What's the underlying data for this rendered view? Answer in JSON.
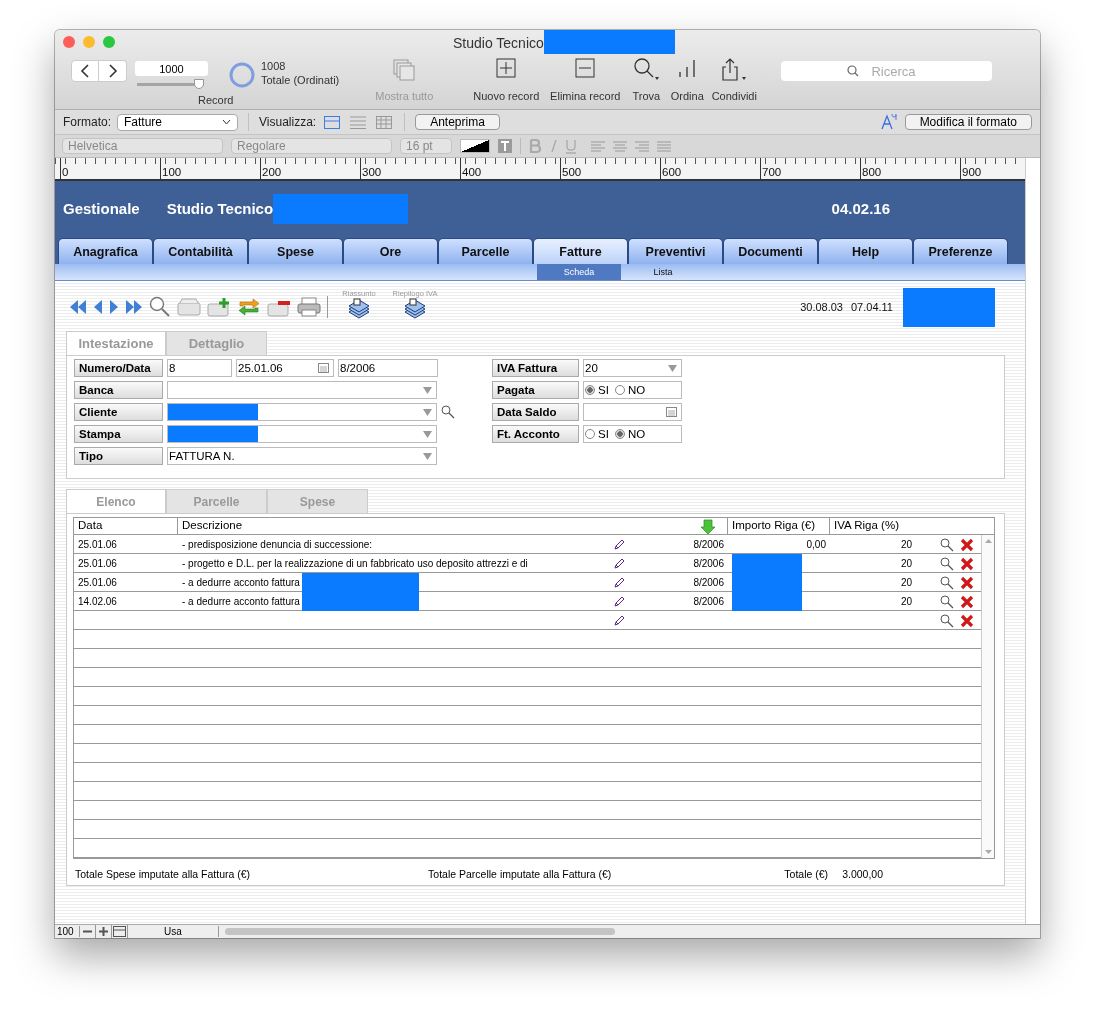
{
  "window": {
    "title": "Studio Tecnico"
  },
  "toolbar": {
    "record_field": "1000",
    "record_slider": {
      "level": 1.0
    },
    "record_label": "Record",
    "count": "1008",
    "count_label": "Totale (Ordinati)",
    "buttons": [
      {
        "kind": "showall",
        "label": "Mostra tutto",
        "disabled": true
      },
      {
        "kind": "new",
        "label": "Nuovo record",
        "disabled": false
      },
      {
        "kind": "delete",
        "label": "Elimina record",
        "disabled": false
      },
      {
        "kind": "find",
        "label": "Trova",
        "disabled": false
      },
      {
        "kind": "sort",
        "label": "Ordina",
        "disabled": false
      },
      {
        "kind": "share",
        "label": "Condividi",
        "disabled": false
      }
    ],
    "search": {
      "placeholder": "Ricerca"
    }
  },
  "format_bar": {
    "format_label": "Formato:",
    "format_value": "Fatture",
    "view_label": "Visualizza:",
    "views": [
      {
        "kind": "form",
        "selected": true
      },
      {
        "kind": "list",
        "selected": false
      },
      {
        "kind": "table",
        "selected": false
      }
    ],
    "preview_button": "Anteprima",
    "edit_format_button": "Modifica il formato"
  },
  "font_bar": {
    "font": "Helvetica",
    "style": "Regolare",
    "size": "16 pt"
  },
  "ruler": {
    "labels": [
      "0",
      "100",
      "200",
      "300",
      "400",
      "500",
      "600",
      "700",
      "800",
      "900"
    ]
  },
  "header": {
    "app": "Gestionale",
    "studio": "Studio Tecnico",
    "date": "04.02.16"
  },
  "nav_tabs": [
    {
      "label": "Anagrafica",
      "selected": false
    },
    {
      "label": "Contabilità",
      "selected": false
    },
    {
      "label": "Spese",
      "selected": false
    },
    {
      "label": "Ore",
      "selected": false
    },
    {
      "label": "Parcelle",
      "selected": false
    },
    {
      "label": "Fatture",
      "selected": true
    },
    {
      "label": "Preventivi",
      "selected": false
    },
    {
      "label": "Documenti",
      "selected": false
    },
    {
      "label": "Help",
      "selected": false
    },
    {
      "label": "Preferenze",
      "selected": false
    }
  ],
  "sub_tabs": [
    {
      "label": "Scheda",
      "selected": true
    },
    {
      "label": "Lista",
      "selected": false
    }
  ],
  "record_toolbar": {
    "report_buttons": [
      "Riassunto",
      "Riepilogo IVA"
    ],
    "dates": [
      "30.08.03",
      "07.04.11"
    ]
  },
  "form_tabs": [
    {
      "label": "Intestazione",
      "selected": true
    },
    {
      "label": "Dettaglio",
      "selected": false
    }
  ],
  "form_left": [
    {
      "label": "Numero/Data",
      "kind": "numdate",
      "values": [
        "8",
        "25.01.06",
        "8/2006"
      ]
    },
    {
      "label": "Banca",
      "kind": "dropdown"
    },
    {
      "label": "Cliente",
      "kind": "lookup",
      "redacted": true
    },
    {
      "label": "Stampa",
      "kind": "dropdown",
      "redacted": true
    },
    {
      "label": "Tipo",
      "kind": "dropdown",
      "value": "FATTURA N."
    }
  ],
  "form_right": [
    {
      "label": "IVA Fattura",
      "kind": "dropdown",
      "value": "20"
    },
    {
      "label": "Pagata",
      "kind": "radio",
      "options": [
        {
          "label": "SI",
          "selected": true
        },
        {
          "label": "NO",
          "selected": false
        }
      ]
    },
    {
      "label": "Data Saldo",
      "kind": "date"
    },
    {
      "label": "Ft. Acconto",
      "kind": "radio",
      "options": [
        {
          "label": "SI",
          "selected": false
        },
        {
          "label": "NO",
          "selected": true
        }
      ]
    }
  ],
  "detail_tabs": [
    {
      "label": "Elenco",
      "selected": true
    },
    {
      "label": "Parcelle",
      "selected": false
    },
    {
      "label": "Spese",
      "selected": false
    }
  ],
  "table": {
    "columns": [
      "Data",
      "Descrizione",
      "Importo Riga (€)",
      "IVA Riga (%)"
    ],
    "rows": [
      {
        "date": "25.01.06",
        "description": "- predisposizione denuncia di successione:",
        "ref": "8/2006",
        "amount": "0,00",
        "vat": "20"
      },
      {
        "date": "25.01.06",
        "description": "- progetto e D.L. per la realizzazione di un fabbricato uso deposito attrezzi e di",
        "ref": "8/2006",
        "amount_redacted": true,
        "vat": "20"
      },
      {
        "date": "25.01.06",
        "description": "- a dedurre acconto fattura",
        "description_redacted": true,
        "ref": "8/2006",
        "amount_redacted": true,
        "vat": "20"
      },
      {
        "date": "14.02.06",
        "description": "- a dedurre acconto fattura",
        "description_redacted": true,
        "ref": "8/2006",
        "amount_redacted": true,
        "vat": "20"
      },
      {}
    ]
  },
  "totals": {
    "spese_label": "Totale Spese imputate alla Fattura (€)",
    "parcelle_label": "Totale Parcelle imputate alla Fattura (€)",
    "total_label": "Totale (€)",
    "total_value": "3.000,00"
  },
  "status_bar": {
    "zoom": "100",
    "mode": "Usa"
  }
}
